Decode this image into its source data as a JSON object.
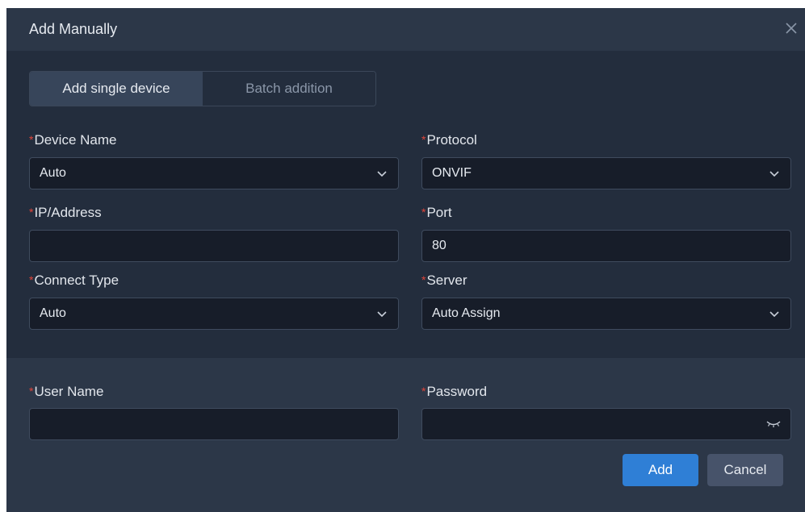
{
  "dialog": {
    "title": "Add Manually",
    "close_icon": "close-icon"
  },
  "tabs": [
    {
      "label": "Add single device",
      "active": true
    },
    {
      "label": "Batch addition",
      "active": false
    }
  ],
  "fields": {
    "device_name": {
      "label": "Device Name",
      "value": "Auto",
      "type": "select"
    },
    "protocol": {
      "label": "Protocol",
      "value": "ONVIF",
      "type": "select"
    },
    "ip_address": {
      "label": "IP/Address",
      "value": "",
      "type": "text"
    },
    "port": {
      "label": "Port",
      "value": "80",
      "type": "text"
    },
    "connect_type": {
      "label": "Connect Type",
      "value": "Auto",
      "type": "select"
    },
    "server": {
      "label": "Server",
      "value": "Auto Assign",
      "type": "select"
    },
    "user_name": {
      "label": "User Name",
      "value": "",
      "type": "text"
    },
    "password": {
      "label": "Password",
      "value": "",
      "type": "password",
      "icon": "eye-closed-icon"
    }
  },
  "required_marker": "*",
  "buttons": {
    "add": "Add",
    "cancel": "Cancel"
  },
  "colors": {
    "background": "#232d3d",
    "header": "#2c3748",
    "input_bg": "#171d29",
    "accent": "#2f7fd6",
    "required": "#e0453a"
  }
}
